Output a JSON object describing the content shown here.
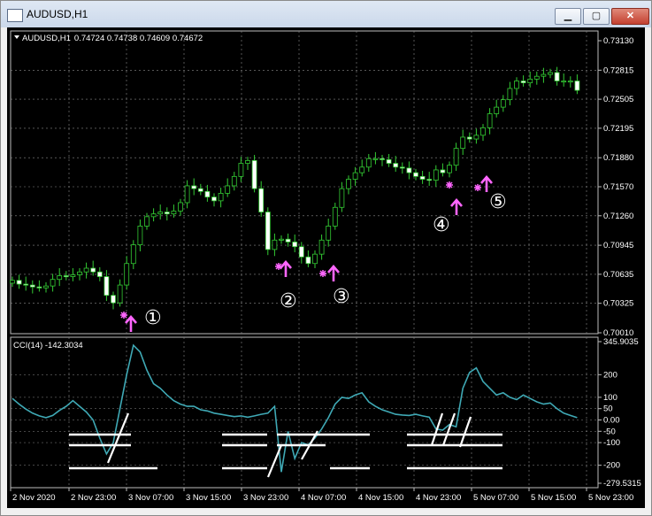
{
  "window": {
    "title": "AUDUSD,H1",
    "close_label": "✕"
  },
  "price_panel": {
    "symbol_tf": "AUDUSD,H1",
    "ohlc": "0.74724 0.74738 0.74609 0.74672",
    "price_labels": [
      "0.73130",
      "0.72815",
      "0.72505",
      "0.72195",
      "0.71880",
      "0.71570",
      "0.71260",
      "0.70945",
      "0.70635",
      "0.70325",
      "0.70010"
    ]
  },
  "cci_panel": {
    "label": "CCI(14) -142.3034",
    "level_labels": [
      "345.9035",
      "200",
      "100",
      "50",
      "0.00",
      "-50",
      "-100",
      "-200",
      "-279.5315"
    ]
  },
  "time_axis": [
    "2 Nov 2020",
    "2 Nov 23:00",
    "3 Nov 07:00",
    "3 Nov 15:00",
    "3 Nov 23:00",
    "4 Nov 07:00",
    "4 Nov 15:00",
    "4 Nov 23:00",
    "5 Nov 07:00",
    "5 Nov 15:00",
    "5 Nov 23:00"
  ],
  "annotations": [
    "①",
    "②",
    "③",
    "④",
    "⑤"
  ],
  "colors": {
    "background": "#000000",
    "grid": "#8a8a8a",
    "candle": "#33cc33",
    "bull_body": "#000000",
    "bear_body": "#ffffff",
    "cci_line": "#3fa9b5",
    "arrow": "#ff66ff",
    "text": "#ffffff"
  },
  "chart_data": [
    {
      "type": "candlestick",
      "symbol": "AUDUSD",
      "timeframe": "H1",
      "ylim": [
        0.7001,
        0.7313
      ],
      "current_bar": {
        "open": 0.74724,
        "high": 0.74738,
        "low": 0.74609,
        "close": 0.74672
      },
      "close_path": [
        0.7057,
        0.7053,
        0.7052,
        0.705,
        0.7049,
        0.7051,
        0.7058,
        0.7062,
        0.7061,
        0.7063,
        0.7066,
        0.707,
        0.7066,
        0.7061,
        0.7041,
        0.7033,
        0.7052,
        0.7075,
        0.7095,
        0.7115,
        0.7125,
        0.7128,
        0.713,
        0.7128,
        0.7131,
        0.714,
        0.7158,
        0.7155,
        0.7152,
        0.7146,
        0.7142,
        0.715,
        0.7158,
        0.7168,
        0.7182,
        0.7185,
        0.7155,
        0.713,
        0.709,
        0.71,
        0.7101,
        0.7098,
        0.7093,
        0.7082,
        0.7075,
        0.7085,
        0.71,
        0.7115,
        0.7135,
        0.7155,
        0.7165,
        0.7172,
        0.7178,
        0.7187,
        0.7187,
        0.7186,
        0.7182,
        0.7178,
        0.7177,
        0.7172,
        0.7168,
        0.7165,
        0.7164,
        0.7175,
        0.7172,
        0.718,
        0.7198,
        0.721,
        0.7208,
        0.7212,
        0.722,
        0.7235,
        0.7242,
        0.725,
        0.7262,
        0.727,
        0.7268,
        0.7272,
        0.7275,
        0.7277,
        0.7279,
        0.727,
        0.727,
        0.727,
        0.726
      ]
    },
    {
      "type": "line",
      "series": [
        {
          "name": "CCI(14)"
        }
      ],
      "ylim": [
        -279.5315,
        345.9035
      ],
      "levels": [
        200,
        100,
        50,
        0,
        -50,
        -100,
        -200
      ],
      "values": [
        95,
        70,
        48,
        30,
        18,
        10,
        20,
        42,
        60,
        85,
        60,
        35,
        0,
        -80,
        -150,
        -100,
        50,
        200,
        330,
        300,
        220,
        160,
        140,
        110,
        85,
        70,
        60,
        60,
        45,
        40,
        30,
        25,
        20,
        15,
        18,
        12,
        18,
        25,
        30,
        60,
        -230,
        -50,
        -170,
        -100,
        -110,
        -80,
        -40,
        10,
        70,
        100,
        95,
        110,
        120,
        80,
        60,
        45,
        35,
        25,
        22,
        20,
        25,
        18,
        12,
        -40,
        -45,
        -20,
        -30,
        140,
        210,
        230,
        170,
        140,
        110,
        120,
        100,
        90,
        110,
        95,
        80,
        70,
        75,
        50,
        30,
        20,
        10
      ]
    }
  ]
}
